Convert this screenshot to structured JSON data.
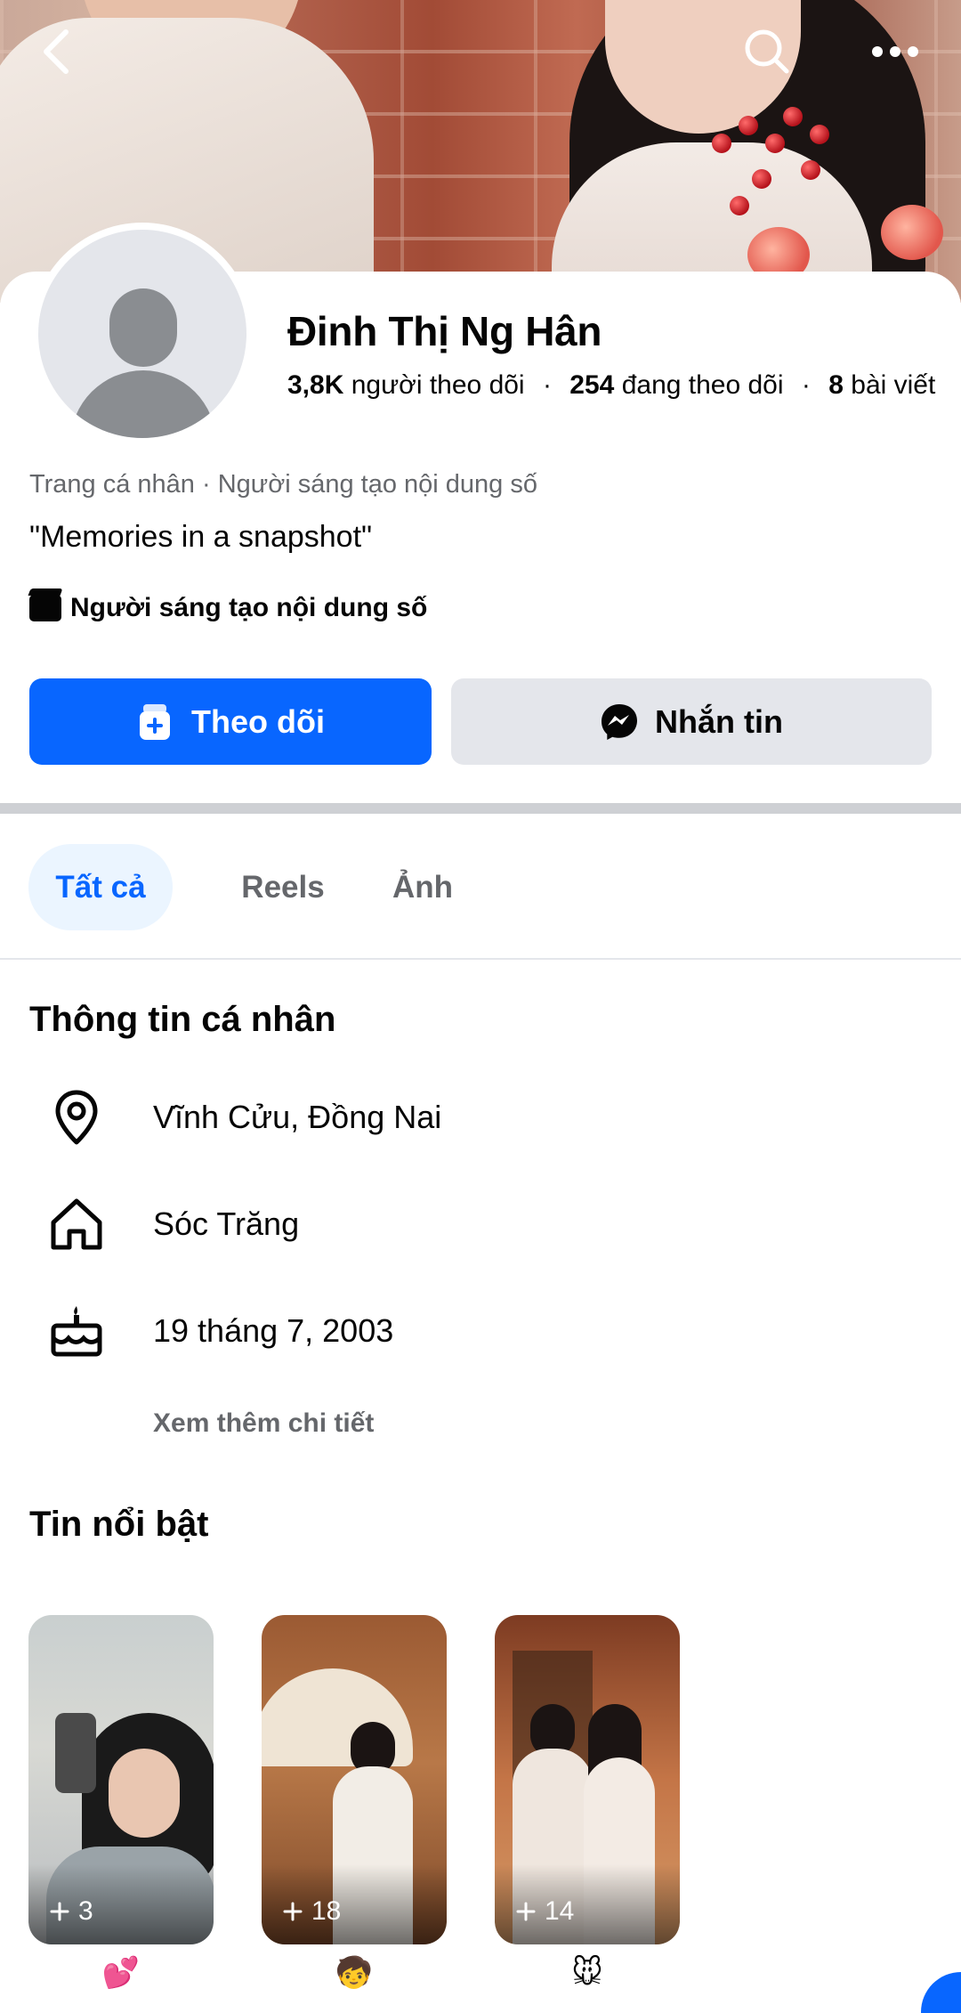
{
  "profile": {
    "name": "Đinh Thị Ng Hân",
    "followers_count": "3,8K",
    "followers_label": "người theo dõi",
    "following_count": "254",
    "following_label": "đang theo dõi",
    "posts_count": "8",
    "posts_label": "bài viết",
    "separator": "·",
    "category": "Trang cá nhân · Người sáng tạo nội dung số",
    "bio": "\"Memories in a snapshot\"",
    "creator_badge": "Người sáng tạo nội dung số"
  },
  "actions": {
    "follow_label": "Theo dõi",
    "message_label": "Nhắn tin"
  },
  "tabs": [
    {
      "label": "Tất cả",
      "active": true
    },
    {
      "label": "Reels",
      "active": false
    },
    {
      "label": "Ảnh",
      "active": false
    }
  ],
  "about": {
    "title": "Thông tin cá nhân",
    "items": [
      {
        "icon": "location-pin-icon",
        "text": "Vĩnh Cửu, Đồng Nai"
      },
      {
        "icon": "home-icon",
        "text": "Sóc Trăng"
      },
      {
        "icon": "birthday-cake-icon",
        "text": "19 tháng 7, 2003"
      }
    ],
    "see_more": "Xem thêm chi tiết"
  },
  "highlights": {
    "title": "Tin nổi bật",
    "items": [
      {
        "count": "3",
        "emoji": "💕"
      },
      {
        "count": "18",
        "emoji": "🧒"
      },
      {
        "count": "14",
        "emoji": "🐭"
      }
    ]
  },
  "colors": {
    "accent": "#0866ff",
    "secondary_button": "#e4e6eb",
    "muted_text": "#65676b",
    "active_tab_bg": "#ebf5ff"
  }
}
